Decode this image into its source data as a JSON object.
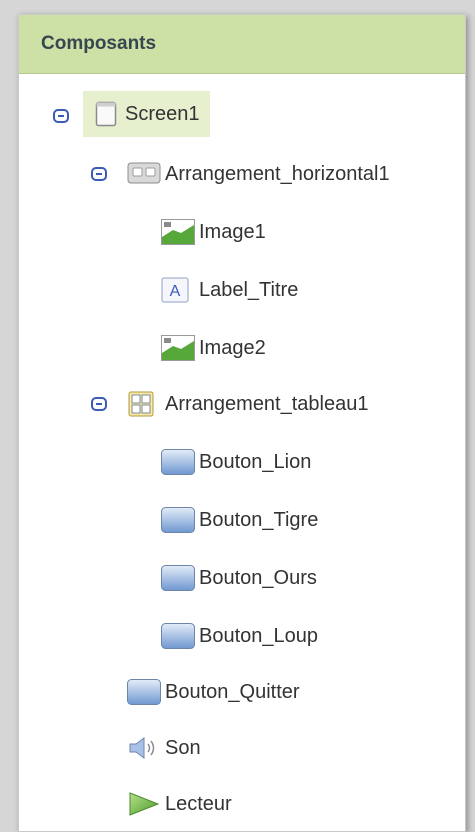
{
  "panel": {
    "title": "Composants"
  },
  "tree": {
    "screen": "Screen1",
    "arrangement_horizontal": "Arrangement_horizontal1",
    "image1": "Image1",
    "label_titre": "Label_Titre",
    "image2": "Image2",
    "arrangement_tableau": "Arrangement_tableau1",
    "bouton_lion": "Bouton_Lion",
    "bouton_tigre": "Bouton_Tigre",
    "bouton_ours": "Bouton_Ours",
    "bouton_loup": "Bouton_Loup",
    "bouton_quitter": "Bouton_Quitter",
    "son": "Son",
    "lecteur": "Lecteur"
  },
  "colors": {
    "header_bg": "#cde0a6",
    "selected_bg": "#e6f0cf",
    "toggle": "#3b5bb5"
  }
}
